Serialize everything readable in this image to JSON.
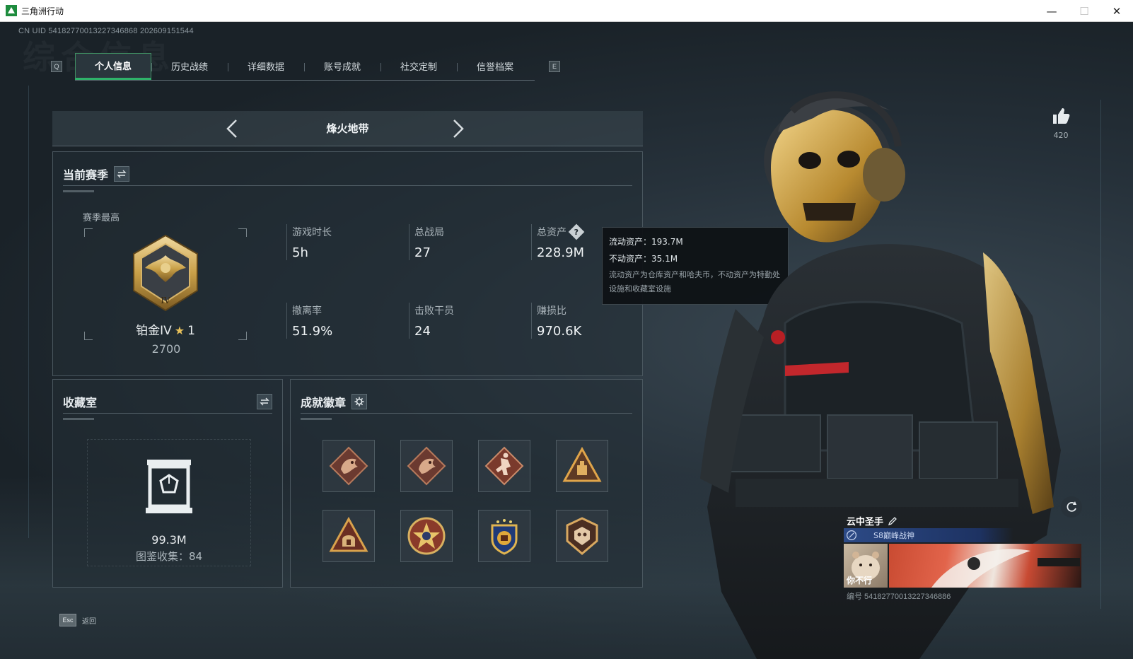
{
  "window": {
    "title": "三角洲行动",
    "controls": {
      "minimize": "—",
      "maximize": "☐",
      "close": "✕"
    }
  },
  "header": {
    "uid": "CN UID 541827700132273468​68 202609151544",
    "bg_title": "综合信息"
  },
  "tabs": {
    "key_left": "Q",
    "key_right": "E",
    "items": [
      {
        "label": "个人信息",
        "active": true
      },
      {
        "label": "历史战绩",
        "active": false
      },
      {
        "label": "详细数据",
        "active": false
      },
      {
        "label": "账号成就",
        "active": false
      },
      {
        "label": "社交定制",
        "active": false
      },
      {
        "label": "信誉档案",
        "active": false
      }
    ]
  },
  "mode": {
    "label": "烽火地带"
  },
  "season": {
    "title": "当前赛季",
    "best_label": "赛季最高",
    "rank_name": "铂金IV",
    "rank_star": "★",
    "rank_stars": "1",
    "rank_points": "2700",
    "stats": [
      {
        "label": "游戏时长",
        "value": "5h"
      },
      {
        "label": "总战局",
        "value": "27"
      },
      {
        "label": "总资产",
        "value": "228.9M",
        "help": "?"
      },
      {
        "label": "撤离率",
        "value": "51.9%"
      },
      {
        "label": "击败干员",
        "value": "24"
      },
      {
        "label": "赚损比",
        "value": "970.6K"
      }
    ]
  },
  "tooltip": {
    "liquid": "流动资产：193.7M",
    "fixed": "不动资产：35.1M",
    "desc": "流动资产为仓库资产和哈夫币，不动资产为特勤处设施和收藏室设施"
  },
  "collection": {
    "title": "收藏室",
    "value": "99.3M",
    "count": "图鉴收集：84"
  },
  "badges": {
    "title": "成就徽章",
    "items": [
      "dragon-badge-icon",
      "dragon-badge-icon",
      "runner-badge-icon",
      "vault-triangle-badge-icon",
      "bunker-triangle-badge-icon",
      "star-emblem-badge-icon",
      "crest-badge-icon",
      "shield-skull-badge-icon"
    ]
  },
  "likes": {
    "count": "420"
  },
  "player_card": {
    "name": "云中圣手",
    "title": "S8巅峰战神",
    "avatar_label": "你不行",
    "id": "编号 54182770013227346886"
  },
  "footer": {
    "esc": "Esc",
    "back": "返回"
  },
  "colors": {
    "accent_green": "#2fb36a",
    "gold": "#c9a048",
    "panel_border": "#4a575f"
  }
}
